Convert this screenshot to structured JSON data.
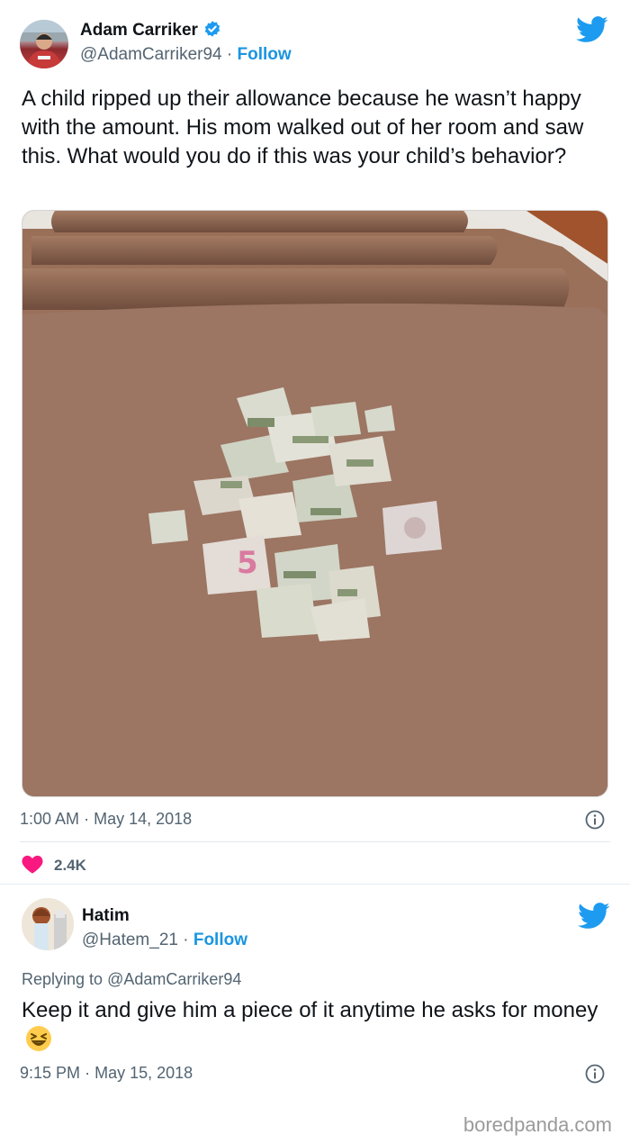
{
  "tweets": [
    {
      "name": "Adam Carriker",
      "handle": "@AdamCarriker94",
      "separator": "·",
      "follow": "Follow",
      "text": "A child ripped up their allowance because he wasn’t happy with the amount. His mom walked out of her room and saw this. What would you do if this was your child’s behavior?",
      "time": "1:00 AM",
      "date": "May 14, 2018",
      "likes": "2.4K"
    },
    {
      "name": "Hatim",
      "handle": "@Hatem_21",
      "separator": "·",
      "follow": "Follow",
      "reply_prefix": "Replying to",
      "reply_handle": "@AdamCarriker94",
      "text": "Keep it and give him a piece of it anytime he asks for money",
      "emoji": "grinning-squinting-face",
      "time": "9:15 PM",
      "date": "May 15, 2018"
    }
  ],
  "footer": "boredpanda.com",
  "colors": {
    "twitter_blue": "#1d9bf0",
    "follow_blue": "#1b95e0",
    "like_pink": "#f91880",
    "muted_text": "#536471"
  }
}
